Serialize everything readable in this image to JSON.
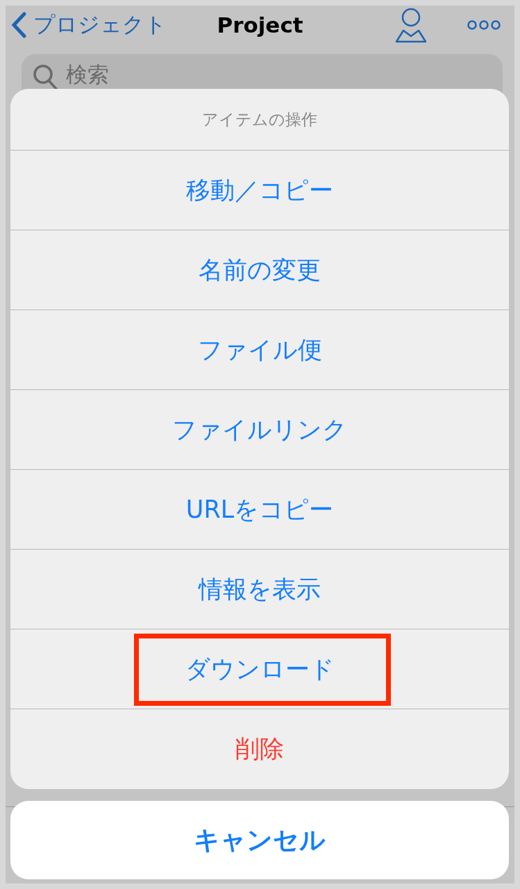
{
  "nav_bar": {
    "back_label": "プロジェクト",
    "title": "Project"
  },
  "search": {
    "placeholder": "検索"
  },
  "action_sheet": {
    "title": "アイテムの操作",
    "actions": [
      {
        "label": "移動／コピー",
        "kind": "default",
        "highlighted": false
      },
      {
        "label": "名前の変更",
        "kind": "default",
        "highlighted": false
      },
      {
        "label": "ファイル便",
        "kind": "default",
        "highlighted": false
      },
      {
        "label": "ファイルリンク",
        "kind": "default",
        "highlighted": false
      },
      {
        "label": "URLをコピー",
        "kind": "default",
        "highlighted": false
      },
      {
        "label": "情報を表示",
        "kind": "default",
        "highlighted": false
      },
      {
        "label": "ダウンロード",
        "kind": "default",
        "highlighted": true
      },
      {
        "label": "削除",
        "kind": "destructive",
        "highlighted": false
      }
    ],
    "cancel_label": "キャンセル"
  }
}
